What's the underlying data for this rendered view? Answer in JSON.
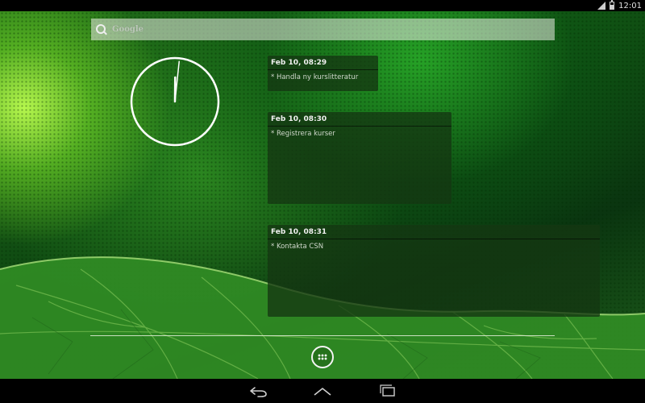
{
  "status_bar": {
    "time": "12:01",
    "icons": [
      "signal-icon",
      "battery-icon"
    ]
  },
  "search": {
    "logo_text": "Google",
    "icon": "search-icon"
  },
  "clock": {
    "type": "analog",
    "hour": 12,
    "minute": 1
  },
  "notes": [
    {
      "date": "Feb 10, 08:29",
      "text": "* Handla ny kurslitteratur"
    },
    {
      "date": "Feb 10, 08:30",
      "text": "* Registrera kurser"
    },
    {
      "date": "Feb 10, 08:31",
      "text": "* Kontakta CSN"
    }
  ],
  "dock": {
    "apps_icon": "all-apps-icon"
  },
  "nav_bar": {
    "icons": [
      "back-icon",
      "home-icon",
      "recents-icon"
    ]
  },
  "colors": {
    "accent": "#2e8b22",
    "note_bg": "#143712"
  }
}
